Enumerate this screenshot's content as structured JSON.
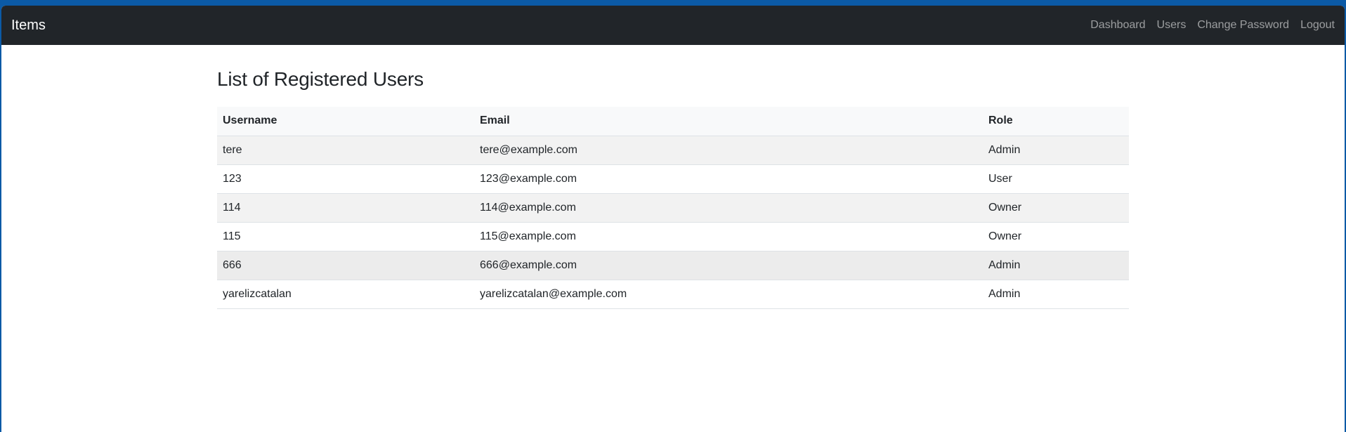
{
  "navbar": {
    "brand": "Items",
    "links": [
      "Dashboard",
      "Users",
      "Change Password",
      "Logout"
    ]
  },
  "page": {
    "title": "List of Registered Users"
  },
  "table": {
    "headers": [
      "Username",
      "Email",
      "Role"
    ],
    "rows": [
      [
        "tere",
        "tere@example.com",
        "Admin"
      ],
      [
        "123",
        "123@example.com",
        "User"
      ],
      [
        "114",
        "114@example.com",
        "Owner"
      ],
      [
        "115",
        "115@example.com",
        "Owner"
      ],
      [
        "666",
        "666@example.com",
        "Admin"
      ],
      [
        "yarelizcatalan",
        "yarelizcatalan@example.com",
        "Admin"
      ]
    ]
  },
  "colors": {
    "navbar_bg": "#212529",
    "frame_bg": "#0b5aa6",
    "stripe": "#f2f2f2",
    "header_bg": "#f8f9fa"
  }
}
